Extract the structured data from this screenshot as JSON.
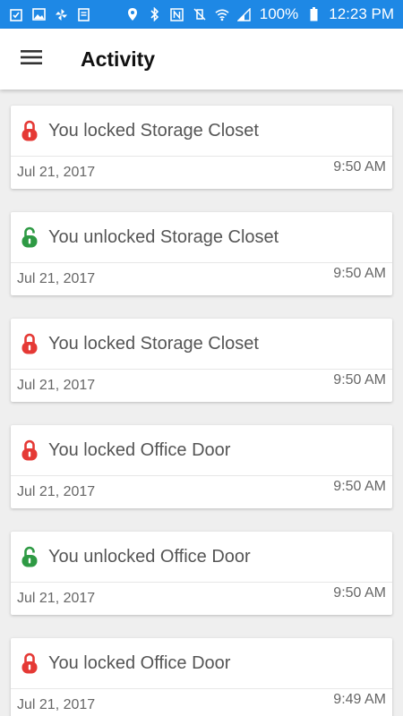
{
  "status_bar": {
    "battery": "100%",
    "time": "12:23 PM"
  },
  "app_bar": {
    "title": "Activity",
    "menu_icon": "hamburger-menu-icon"
  },
  "colors": {
    "locked": "#e53935",
    "unlocked": "#2e9a44",
    "status_bar": "#1e88e5"
  },
  "activity": [
    {
      "message": "You locked Storage Closet",
      "date": "Jul 21, 2017",
      "time": "9:50 AM",
      "state": "locked"
    },
    {
      "message": "You unlocked Storage Closet",
      "date": "Jul 21, 2017",
      "time": "9:50 AM",
      "state": "unlocked"
    },
    {
      "message": "You locked Storage Closet",
      "date": "Jul 21, 2017",
      "time": "9:50 AM",
      "state": "locked"
    },
    {
      "message": "You locked Office Door",
      "date": "Jul 21, 2017",
      "time": "9:50 AM",
      "state": "locked"
    },
    {
      "message": "You unlocked Office Door",
      "date": "Jul 21, 2017",
      "time": "9:50 AM",
      "state": "unlocked"
    },
    {
      "message": "You locked Office Door",
      "date": "Jul 21, 2017",
      "time": "9:49 AM",
      "state": "locked"
    }
  ]
}
